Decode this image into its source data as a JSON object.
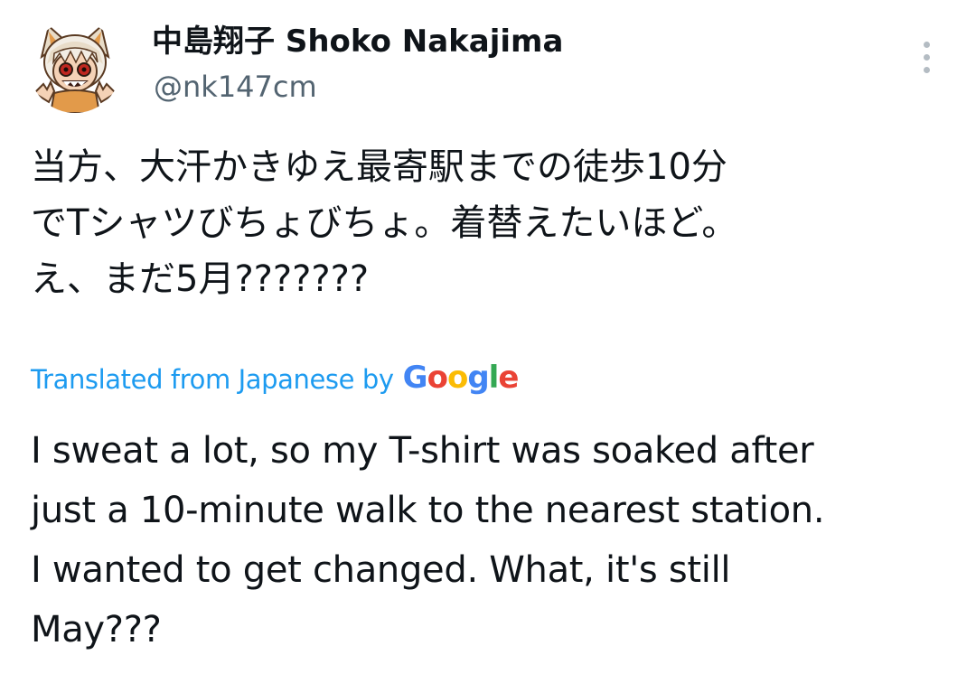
{
  "tweet": {
    "author": {
      "display_name": "中島翔子 Shoko Nakajima",
      "handle": "@nk147cm",
      "avatar_icon": "user-avatar-illustration"
    },
    "more_icon": "more-vertical-icon",
    "original_text_lines": [
      "当方、大汗かきゆえ最寄駅までの徒歩10分",
      "でTシャツびちょびちょ。着替えたいほど。",
      "え、まだ5月???????"
    ],
    "translation": {
      "label": "Translated from Japanese by",
      "provider": "Google",
      "label_color": "#1d9bf0",
      "provider_colors": [
        "#4285f4",
        "#ea4335",
        "#fbbc05",
        "#4285f4",
        "#34a853",
        "#ea4335"
      ]
    },
    "translated_text_lines": [
      "I sweat a lot, so my T-shirt was soaked after",
      "just a 10-minute walk to the nearest station.",
      "I wanted to get changed. What, it's still",
      "May???"
    ]
  }
}
